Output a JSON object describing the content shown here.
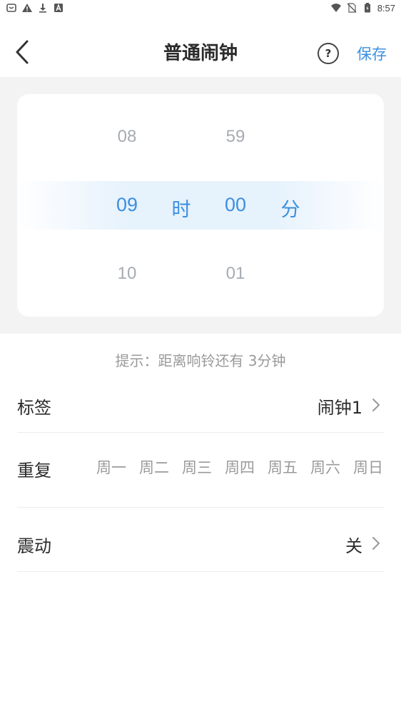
{
  "status_bar": {
    "time": "8:57"
  },
  "header": {
    "title": "普通闹钟",
    "help_label": "?",
    "save_label": "保存"
  },
  "picker": {
    "hour": {
      "prev": "08",
      "selected": "09",
      "next": "10",
      "unit": "时"
    },
    "minute": {
      "prev": "59",
      "selected": "00",
      "next": "01",
      "unit": "分"
    }
  },
  "hint": "提示：距离响铃还有 3分钟",
  "settings": {
    "label": {
      "title": "标签",
      "value": "闹钟1"
    },
    "repeat": {
      "title": "重复",
      "days": [
        "周一",
        "周二",
        "周三",
        "周四",
        "周五",
        "周六",
        "周日"
      ]
    },
    "vibrate": {
      "title": "震动",
      "value": "关"
    }
  },
  "colors": {
    "accent": "#3b8fe0",
    "muted": "#9a9a9a",
    "picker_bg": "#f3f3f3"
  }
}
